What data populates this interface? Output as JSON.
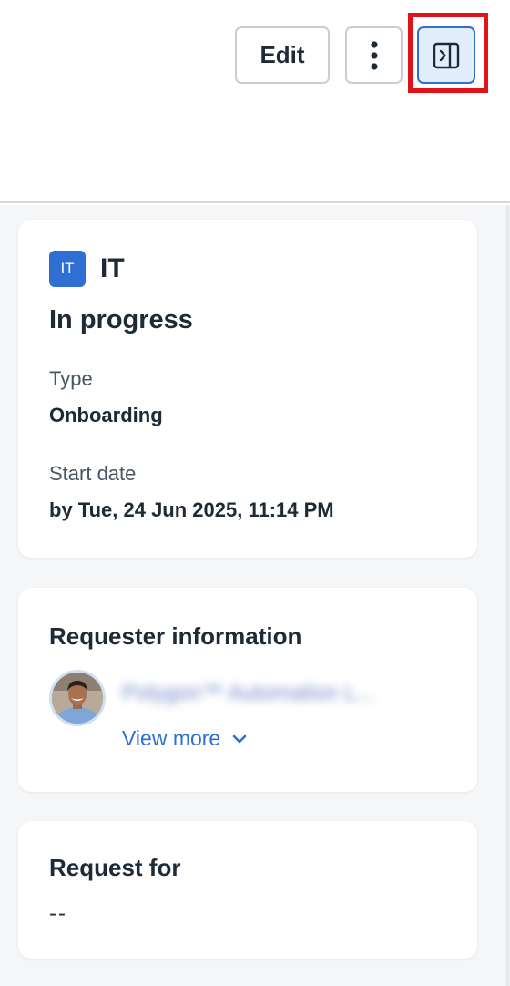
{
  "header": {
    "edit_label": "Edit",
    "more_icon": "kebab-vertical-icon",
    "panel_icon": "collapse-panel-icon"
  },
  "colors": {
    "accent": "#2f6fd4",
    "highlight": "#e0131b",
    "background": "#f5f6f8"
  },
  "summary": {
    "team_badge": "IT",
    "team_name": "IT",
    "status": "In progress",
    "type_label": "Type",
    "type_value": "Onboarding",
    "start_label": "Start date",
    "start_value": "by Tue, 24 Jun 2025, 11:14 PM"
  },
  "requester": {
    "title": "Requester information",
    "name": "Polygon™ Automation L...",
    "view_more": "View more"
  },
  "request_for": {
    "title": "Request for",
    "value": "--"
  }
}
